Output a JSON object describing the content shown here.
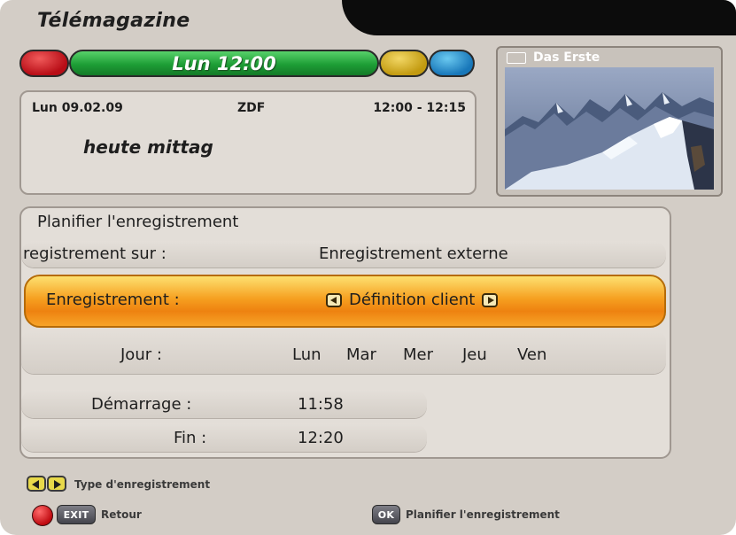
{
  "header": {
    "title": "Télémagazine",
    "green_label": "Lun 12:00"
  },
  "colors": {
    "red": "#c4141c",
    "green": "#23a33b",
    "yellow": "#d4aa18",
    "blue": "#1b86c6",
    "highlight": "#f39a1c"
  },
  "info": {
    "date": "Lun 09.02.09",
    "channel": "ZDF",
    "time": "12:00 - 12:15",
    "program": "heute mittag"
  },
  "preview": {
    "channel_name": "Das Erste",
    "icon": "tv-icon"
  },
  "panel": {
    "title": "Planifier l'enregistrement",
    "rows": [
      {
        "label": "registrement sur   :",
        "value": "Enregistrement externe"
      },
      {
        "label": "Enregistrement   :",
        "value": "Définition client"
      },
      {
        "label": "Jour :",
        "days": [
          "Lun",
          "Mar",
          "Mer",
          "Jeu",
          "Ven"
        ]
      },
      {
        "label": "Démarrage   :",
        "value": "11:58"
      },
      {
        "label": "Fin   :",
        "value": "12:20"
      }
    ]
  },
  "footer": {
    "type_hint": "Type d'enregistrement",
    "back_key": "EXIT",
    "back_label": "Retour",
    "ok_key": "OK",
    "ok_label": "Planifier l'enregistrement"
  }
}
